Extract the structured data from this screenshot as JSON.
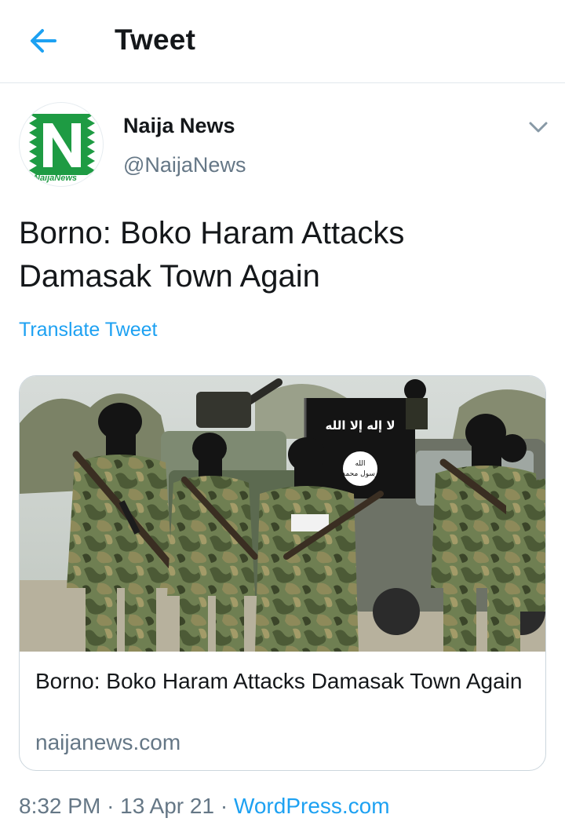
{
  "header": {
    "title": "Tweet",
    "back_icon": "arrow-left-icon"
  },
  "colors": {
    "accent": "#1da1f2",
    "text": "#14171a",
    "secondary": "#657786",
    "brand_green": "#1e9b43"
  },
  "tweet": {
    "author": {
      "name": "Naija News",
      "handle": "@NaijaNews",
      "logo_text": "NaijaNews"
    },
    "text": "Borno: Boko Haram Attacks Damasak Town Again",
    "translate_label": "Translate Tweet",
    "card": {
      "title": "Borno: Boko Haram Attacks Damasak Town Again",
      "domain": "naijanews.com",
      "flag_text": "لا إله إلا الله",
      "seal_text": "الله رسول محمد"
    },
    "meta": {
      "time": "8:32 PM",
      "separator": "·",
      "date": "13 Apr 21",
      "source": "WordPress.com"
    }
  }
}
